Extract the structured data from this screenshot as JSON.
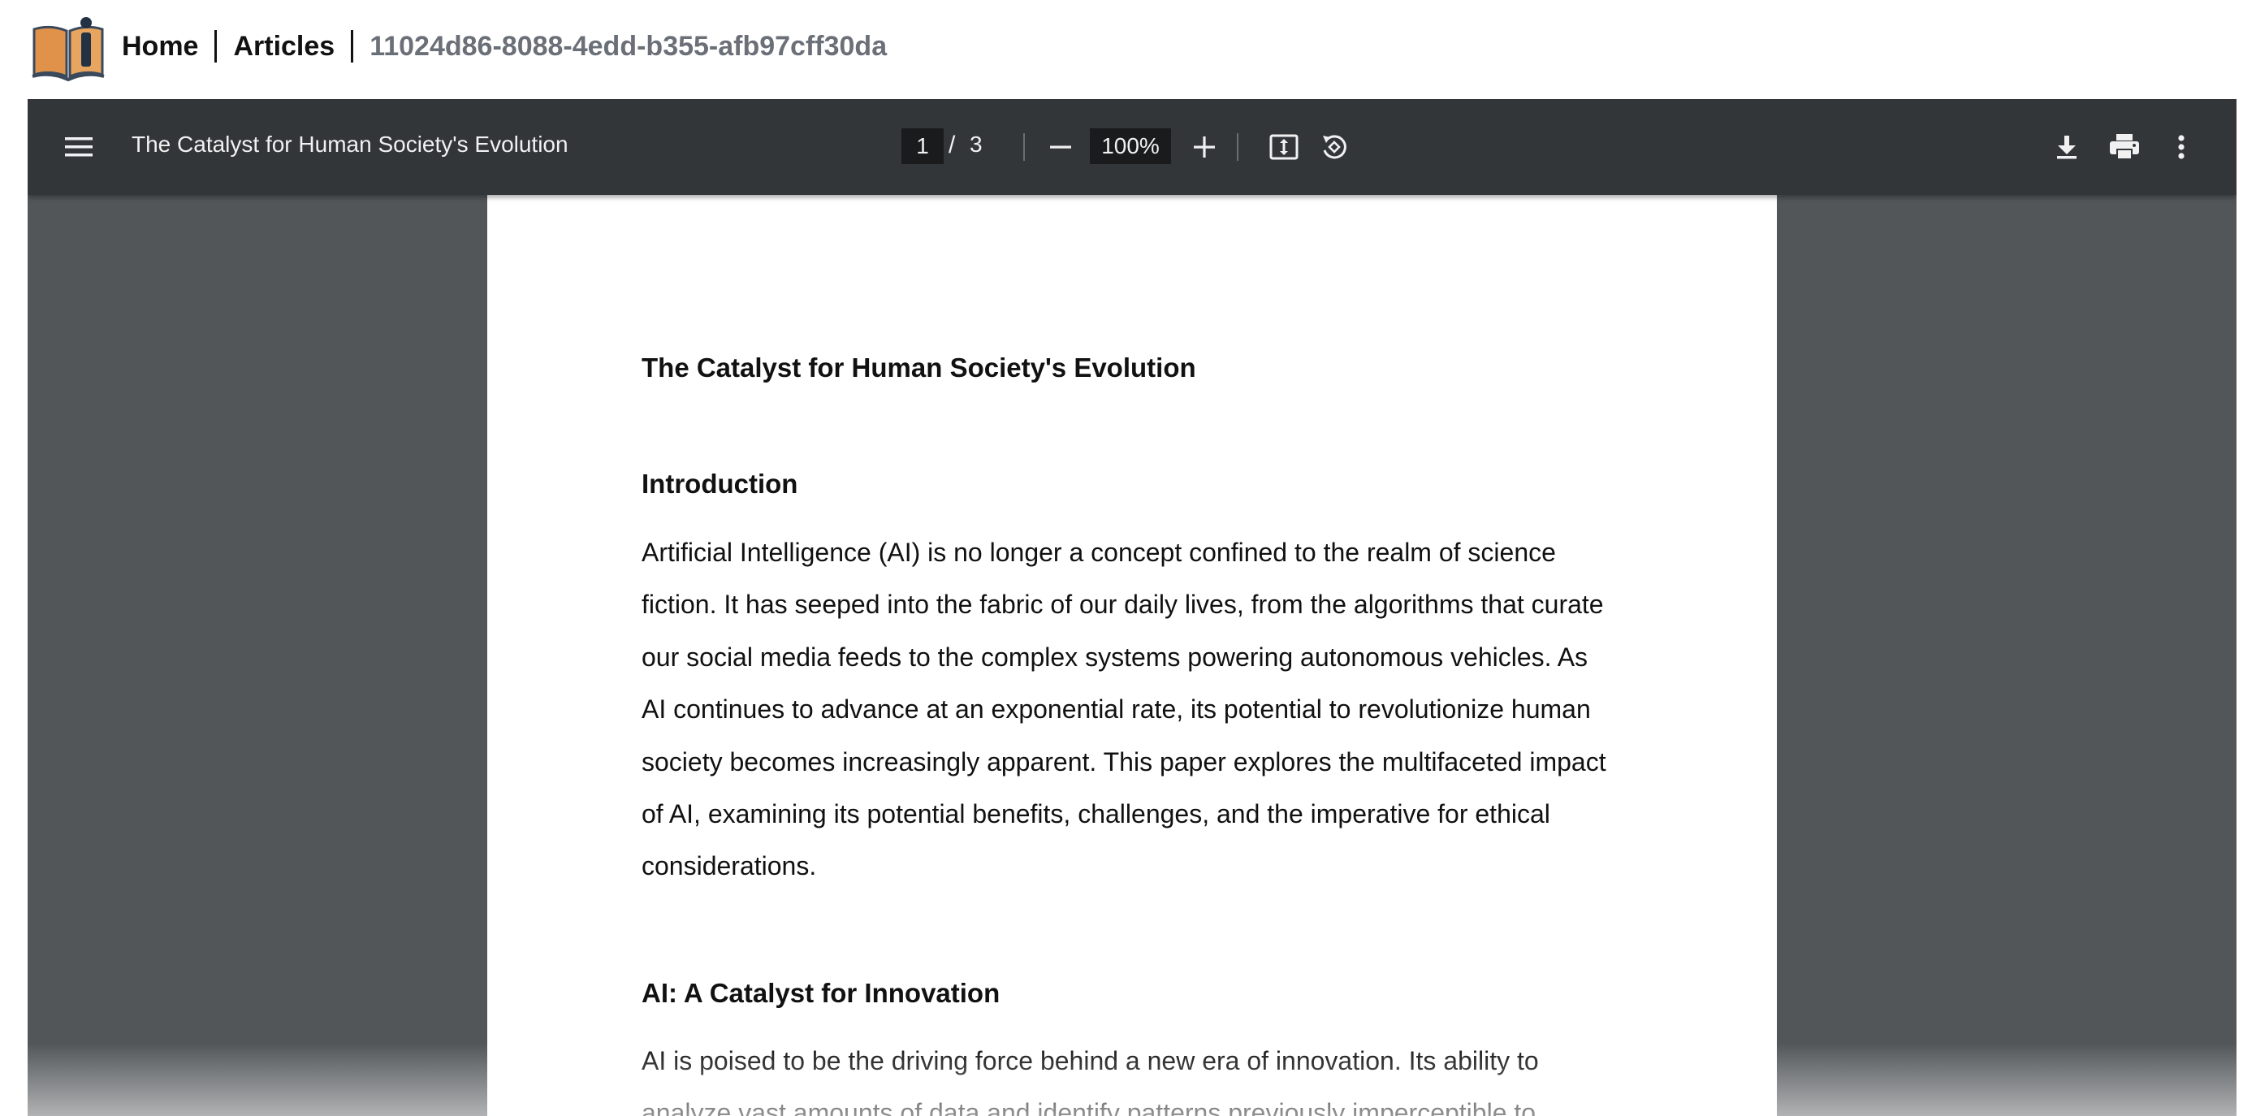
{
  "breadcrumb": {
    "items": [
      "Home",
      "Articles"
    ],
    "current": "11024d86-8088-4edd-b355-afb97cff30da"
  },
  "app": {
    "logo_icon": "open-book-info-icon"
  },
  "viewer": {
    "toolbar": {
      "menu_icon": "hamburger-menu-icon",
      "title": "The Catalyst for Human Society's Evolution",
      "page_current": "1",
      "page_separator": "/",
      "page_total": "3",
      "zoom_out_icon": "minus-icon",
      "zoom_value": "100%",
      "zoom_in_icon": "plus-icon",
      "fit_icon": "fit-to-page-icon",
      "rotate_icon": "rotate-counterclockwise-icon",
      "download_icon": "download-icon",
      "print_icon": "print-icon",
      "more_icon": "more-vert-icon"
    },
    "colors": {
      "toolbar_bg": "#323639",
      "viewer_bg": "#525659",
      "input_bg": "#191b1c"
    }
  },
  "document": {
    "title": "The Catalyst for Human Society's Evolution",
    "sections": [
      {
        "heading": "Introduction",
        "lines": [
          "Artificial Intelligence (AI) is no longer a concept confined to the realm of science",
          "fiction. It has seeped into the fabric of our daily lives, from the algorithms that curate",
          "our social media feeds to the complex systems powering autonomous vehicles. As",
          "AI continues to advance at an exponential rate, its potential to revolutionize human",
          "society becomes increasingly apparent. This paper explores the multifaceted impact",
          "of AI, examining its potential benefits, challenges, and the imperative for ethical",
          "considerations."
        ]
      },
      {
        "heading": "AI: A Catalyst for Innovation",
        "lines": [
          "AI is poised to be the driving force behind a new era of innovation. Its ability to",
          "analyze vast amounts of data and identify patterns previously imperceptible to"
        ]
      }
    ]
  }
}
